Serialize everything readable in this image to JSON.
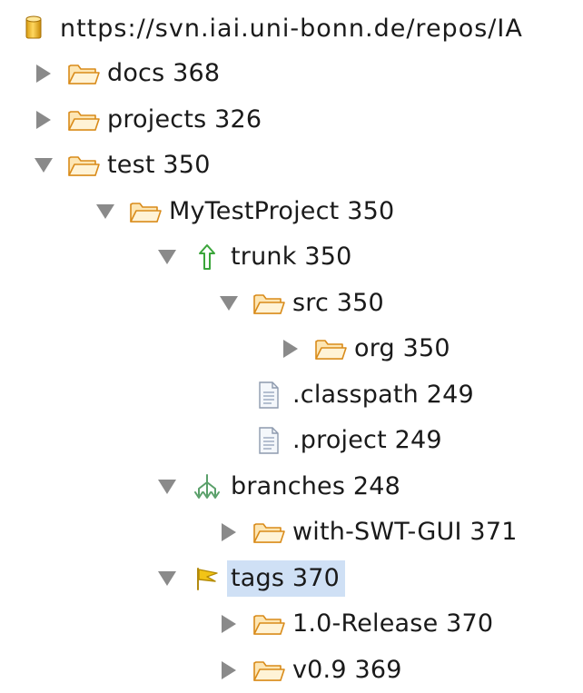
{
  "repository": {
    "url": "nttps://svn.iai.uni-bonn.de/repos/IA",
    "icon": "repository-cylinder-icon"
  },
  "tree": [
    {
      "label": "docs 368",
      "depth": 0,
      "expanded": false,
      "icon": "folder-icon"
    },
    {
      "label": "projects 326",
      "depth": 0,
      "expanded": false,
      "icon": "folder-icon"
    },
    {
      "label": "test 350",
      "depth": 0,
      "expanded": true,
      "icon": "folder-icon"
    },
    {
      "label": "MyTestProject 350",
      "depth": 1,
      "expanded": true,
      "icon": "folder-icon"
    },
    {
      "label": "trunk 350",
      "depth": 2,
      "expanded": true,
      "icon": "trunk-arrow-icon"
    },
    {
      "label": "src 350",
      "depth": 3,
      "expanded": true,
      "icon": "folder-icon"
    },
    {
      "label": "org 350",
      "depth": 4,
      "expanded": false,
      "icon": "folder-icon"
    },
    {
      "label": ".classpath 249",
      "depth": 3,
      "expanded": null,
      "icon": "file-icon"
    },
    {
      "label": ".project 249",
      "depth": 3,
      "expanded": null,
      "icon": "file-icon"
    },
    {
      "label": "branches 248",
      "depth": 2,
      "expanded": true,
      "icon": "branches-icon"
    },
    {
      "label": "with-SWT-GUI 371",
      "depth": 3,
      "expanded": false,
      "icon": "folder-icon"
    },
    {
      "label": "tags 370",
      "depth": 2,
      "expanded": true,
      "icon": "tag-flag-icon",
      "selected": true
    },
    {
      "label": "1.0-Release 370",
      "depth": 3,
      "expanded": false,
      "icon": "folder-icon"
    },
    {
      "label": "v0.9 369",
      "depth": 3,
      "expanded": false,
      "icon": "folder-icon"
    }
  ],
  "colors": {
    "folder_fill": "#fde6b4",
    "folder_stroke": "#d98b1a",
    "twisty": "#8a8a8a",
    "trunk_green": "#3aa53a",
    "branches_green": "#5aa06a",
    "tag_yellow": "#f2c416",
    "selection": "#cfe0f5"
  }
}
